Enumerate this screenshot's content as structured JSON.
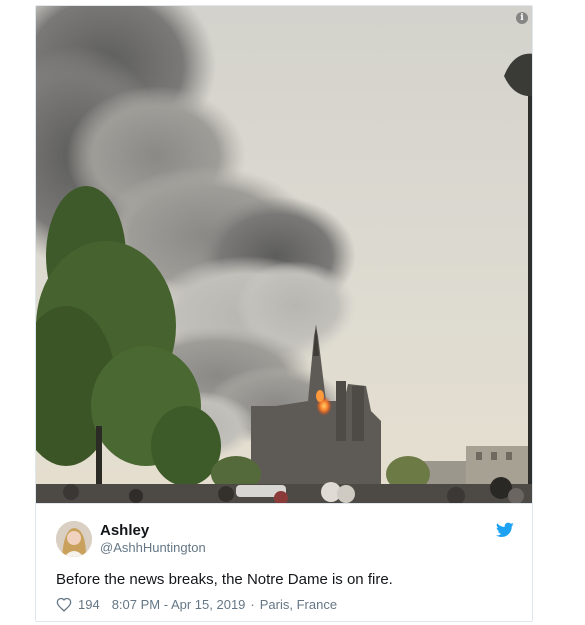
{
  "tweet": {
    "display_name": "Ashley",
    "handle": "@AshhHuntington",
    "text": "Before the news breaks, the Notre Dame is on fire.",
    "likes": "194",
    "time": "8:07 PM - Apr 15, 2019",
    "separator": "·",
    "location": "Paris, France"
  },
  "icons": {
    "info": "info-icon",
    "bird": "twitter-bird-icon",
    "heart": "heart-icon",
    "avatar": "avatar"
  },
  "colors": {
    "twitter_blue": "#1da1f2",
    "text_primary": "#14171a",
    "text_secondary": "#657786",
    "border": "#e1e8ed"
  }
}
